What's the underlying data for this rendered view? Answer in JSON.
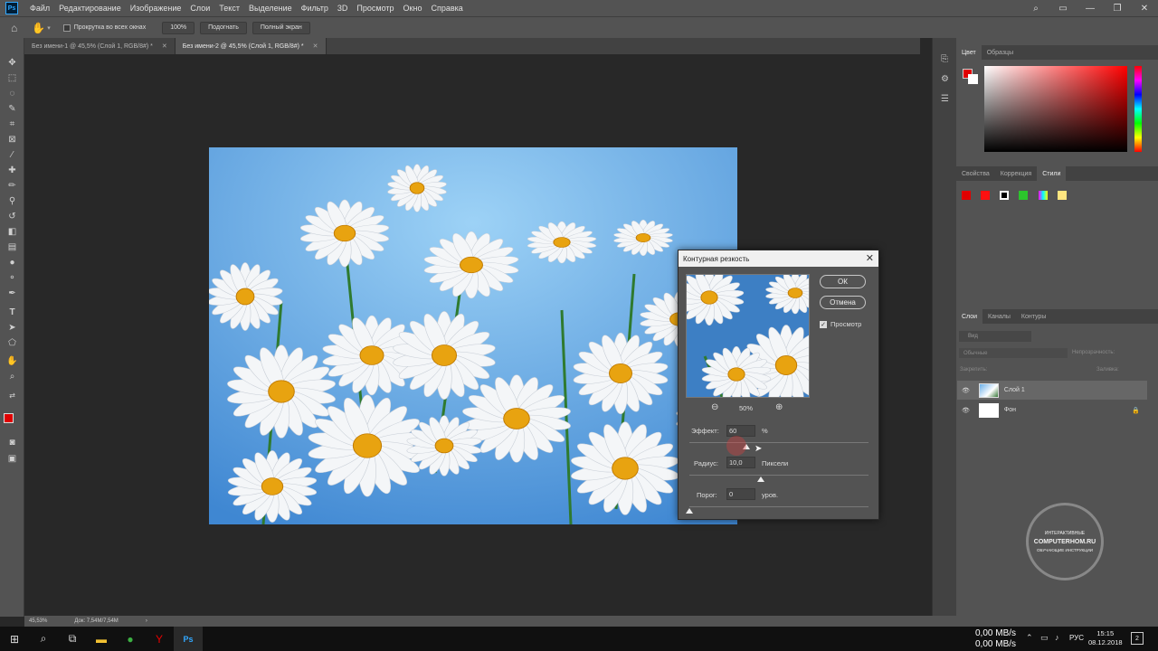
{
  "menu": {
    "items": [
      "Файл",
      "Редактирование",
      "Изображение",
      "Слои",
      "Текст",
      "Выделение",
      "Фильтр",
      "3D",
      "Просмотр",
      "Окно",
      "Справка"
    ]
  },
  "options": {
    "scroll_all": "Прокрутка во всех окнах",
    "zoom_100": "100%",
    "fit": "Подогнать",
    "fullscreen": "Полный экран"
  },
  "tabs": [
    {
      "label": "Без имени-1 @ 45,5% (Слой 1, RGB/8#) *"
    },
    {
      "label": "Без имени-2 @ 45,5% (Слой 1, RGB/8#) *"
    }
  ],
  "status": {
    "zoom": "45,53%",
    "doc": "Док: 7,54M/7,54M"
  },
  "panels": {
    "color_tab": "Цвет",
    "swatches_tab": "Образцы",
    "properties_tab": "Свойства",
    "adjust_tab": "Коррекция",
    "styles_tab": "Стили",
    "layers_tab": "Слои",
    "channels_tab": "Каналы",
    "paths_tab": "Контуры",
    "search_placeholder": "Вид",
    "blend_mode": "Обычные",
    "opacity_label": "Непрозрачность:",
    "lock_label": "Закрепить:",
    "fill_label": "Заливка:",
    "layers": [
      {
        "name": "Слой 1"
      },
      {
        "name": "Фон"
      }
    ]
  },
  "dialog": {
    "title": "Контурная резкость",
    "ok": "ОК",
    "cancel": "Отмена",
    "preview_label": "Просмотр",
    "zoom_pct": "50%",
    "amount_label": "Эффект:",
    "amount_value": "60",
    "amount_unit": "%",
    "radius_label": "Радиус:",
    "radius_value": "10,0",
    "radius_unit": "Пиксели",
    "threshold_label": "Порог:",
    "threshold_value": "0",
    "threshold_unit": "уров.",
    "amount_level": 0.32,
    "radius_level": 0.4,
    "threshold_level": 0
  },
  "watermark": {
    "top": "ИНТЕРАКТИВНЫЕ",
    "middle": "COMPUTERHOM.RU",
    "bottom": "ОБУЧАЮЩИЕ ИНСТРУКЦИИ"
  },
  "taskbar": {
    "net_up": "0,00 MB/s",
    "net_down": "0,00 MB/s",
    "lang": "РУС",
    "time": "15:15",
    "date": "08.12.2018",
    "notif": "2"
  },
  "colors": {
    "fg": "#e00000",
    "accent": "#31a8ff"
  }
}
